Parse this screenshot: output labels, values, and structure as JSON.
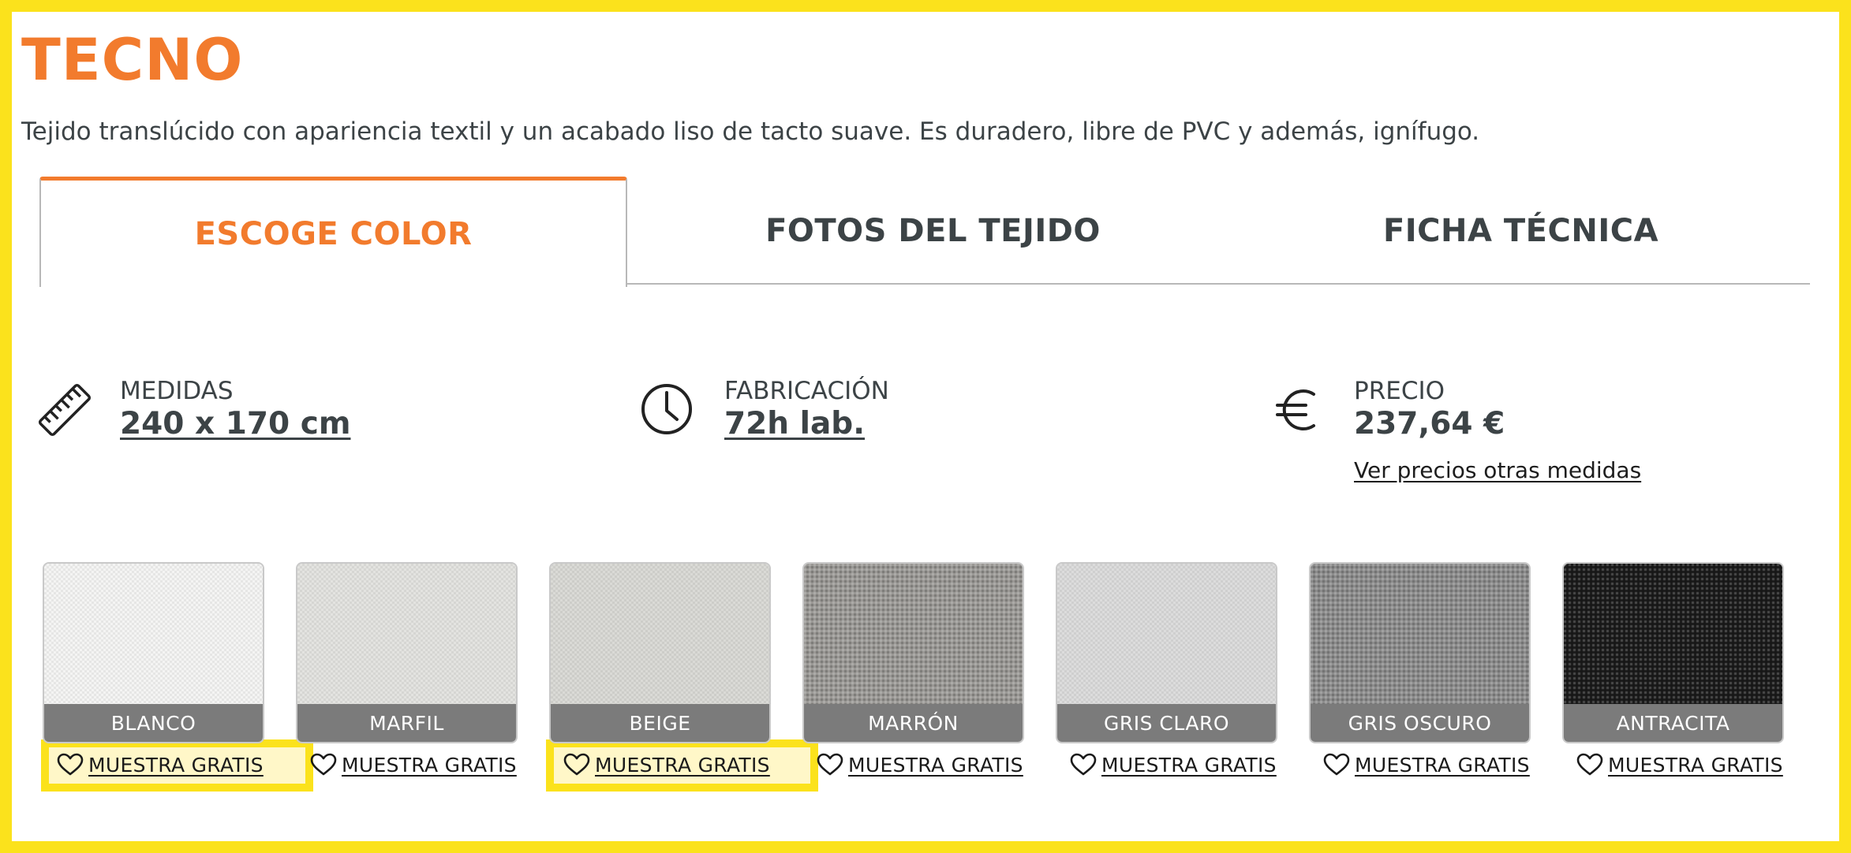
{
  "product": {
    "title": "TECNO",
    "description": "Tejido translúcido con apariencia textil y un acabado liso de tacto suave. Es duradero, libre de PVC y además, ignífugo."
  },
  "tabs": [
    {
      "label": "ESCOGE COLOR",
      "active": true
    },
    {
      "label": "FOTOS DEL TEJIDO",
      "active": false
    },
    {
      "label": "FICHA TÉCNICA",
      "active": false
    }
  ],
  "info": {
    "medidas": {
      "label": "MEDIDAS",
      "value": "240 x 170 cm",
      "icon": "ruler-icon"
    },
    "fabricacion": {
      "label": "FABRICACIÓN",
      "value": "72h lab.",
      "icon": "clock-icon"
    },
    "precio": {
      "label": "PRECIO",
      "value": "237,64 €",
      "link": "Ver precios otras medidas",
      "icon": "euro-icon"
    }
  },
  "swatches": [
    {
      "name": "BLANCO",
      "sample": "MUESTRA GRATIS",
      "color": "#f4f4f3",
      "highlighted": true
    },
    {
      "name": "MARFIL",
      "sample": "MUESTRA GRATIS",
      "color": "#e3e3e0",
      "highlighted": false
    },
    {
      "name": "BEIGE",
      "sample": "MUESTRA GRATIS",
      "color": "#dadad6",
      "highlighted": true
    },
    {
      "name": "MARRÓN",
      "sample": "MUESTRA GRATIS",
      "color": "#9a9895",
      "highlighted": false
    },
    {
      "name": "GRIS CLARO",
      "sample": "MUESTRA GRATIS",
      "color": "#dcdcdc",
      "highlighted": false
    },
    {
      "name": "GRIS OSCURO",
      "sample": "MUESTRA GRATIS",
      "color": "#8c8c8c",
      "highlighted": false
    },
    {
      "name": "ANTRACITA",
      "sample": "MUESTRA GRATIS",
      "color": "#1c1c1c",
      "highlighted": false
    }
  ],
  "colors": {
    "accent": "#f27b2d",
    "frame": "#fbe21c",
    "text": "#3c4346",
    "swatch_label_bg": "#7b7b7b"
  }
}
